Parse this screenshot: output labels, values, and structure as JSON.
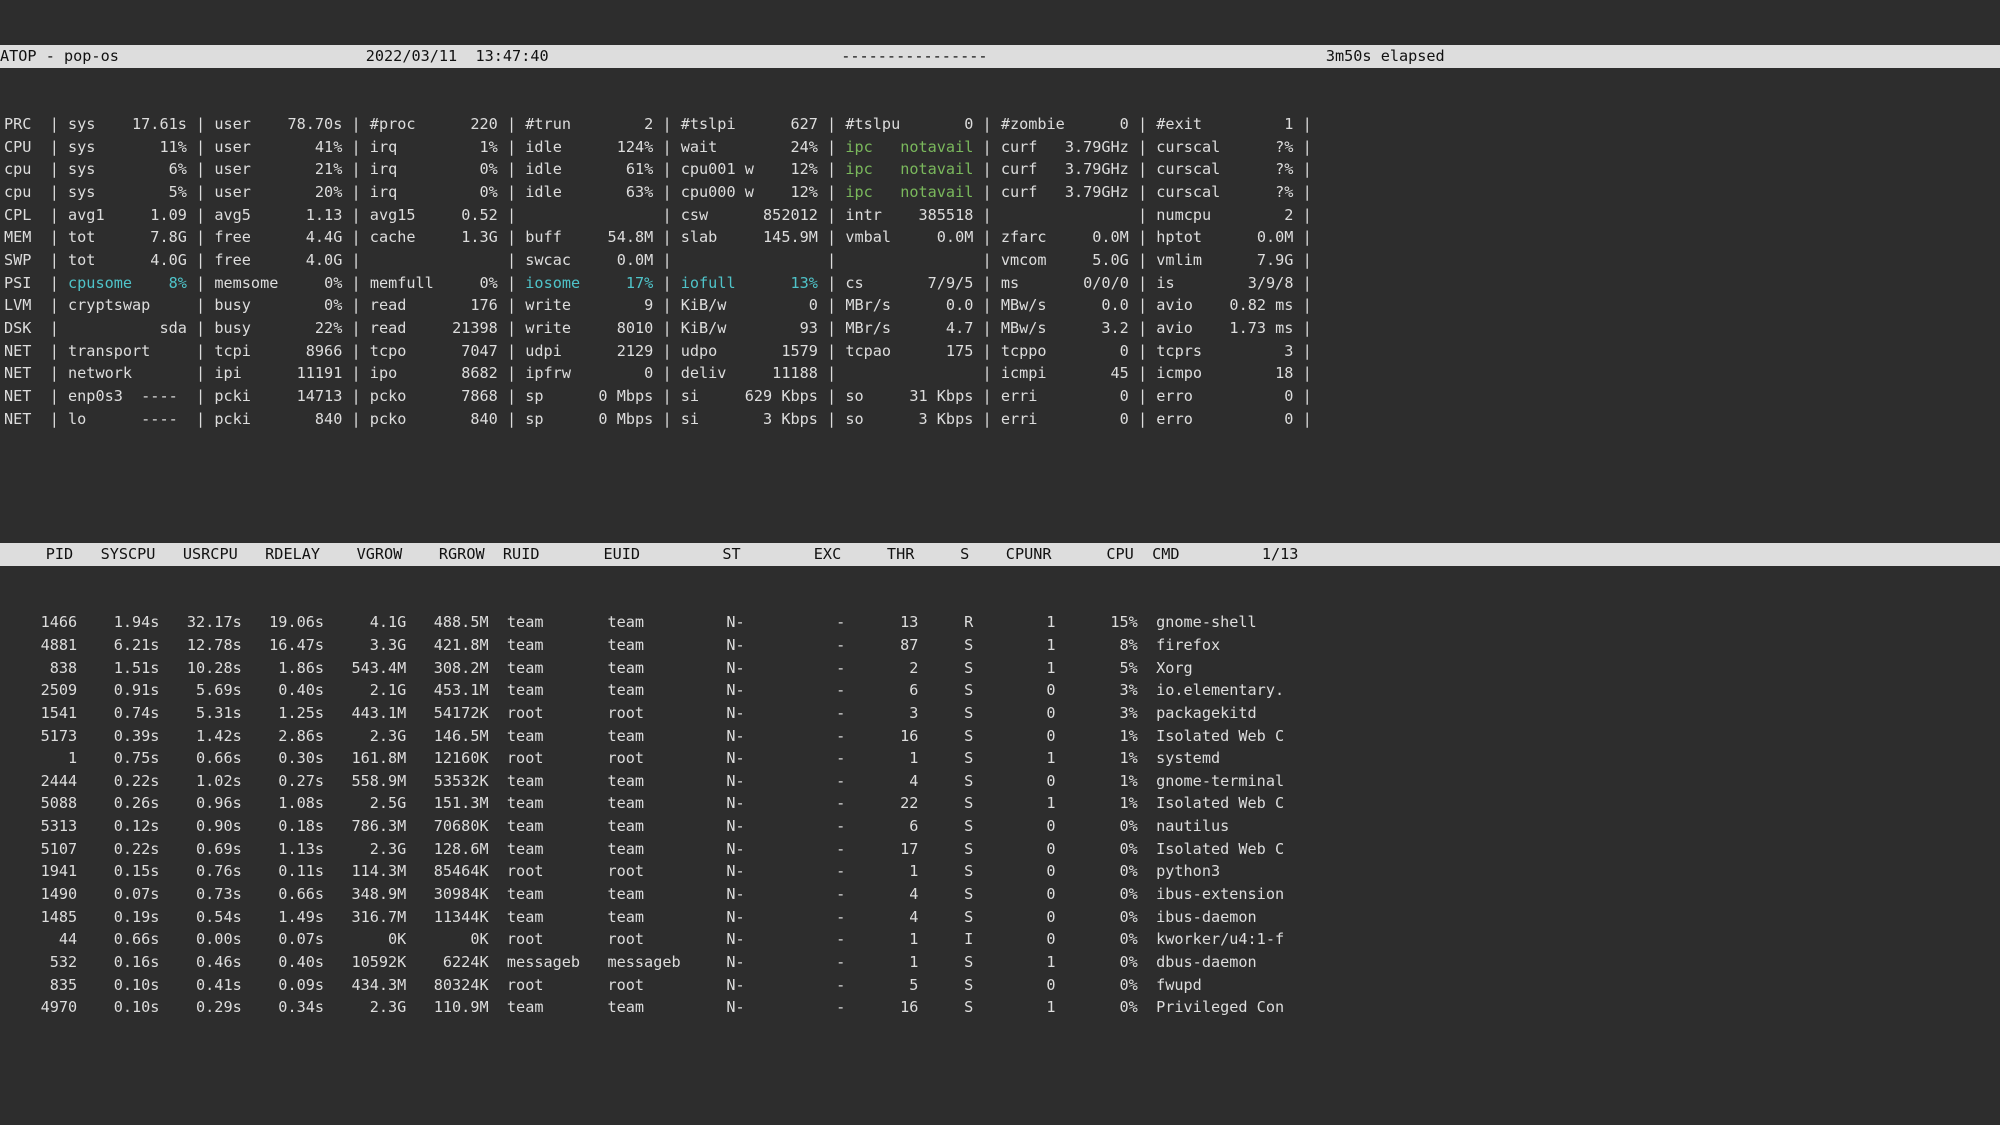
{
  "topbar": {
    "left": "ATOP - pop-os",
    "center": "2022/03/11  13:47:40",
    "dash": "----------------",
    "elapsed": "3m50s elapsed"
  },
  "sys": [
    {
      "c": [
        [
          "PRC",
          ""
        ],
        [
          "sys",
          "17.61s"
        ],
        [
          "user",
          "78.70s"
        ],
        [
          "#proc",
          "220"
        ],
        [
          "#trun",
          "2"
        ],
        [
          "#tslpi",
          "627"
        ],
        [
          "#tslpu",
          "0"
        ],
        [
          "#zombie",
          "0"
        ],
        [
          "#exit",
          "1"
        ]
      ]
    },
    {
      "c": [
        [
          "CPU",
          ""
        ],
        [
          "sys",
          "11%"
        ],
        [
          "user",
          "41%"
        ],
        [
          "irq",
          "1%"
        ],
        [
          "idle",
          "124%"
        ],
        [
          "wait",
          "24%"
        ],
        [
          "ipc",
          "notavail",
          "green"
        ],
        [
          "curf",
          "3.79GHz"
        ],
        [
          "curscal",
          "?%"
        ]
      ]
    },
    {
      "c": [
        [
          "cpu",
          ""
        ],
        [
          "sys",
          "6%"
        ],
        [
          "user",
          "21%"
        ],
        [
          "irq",
          "0%"
        ],
        [
          "idle",
          "61%"
        ],
        [
          "cpu001 w",
          "12%"
        ],
        [
          "ipc",
          "notavail",
          "green"
        ],
        [
          "curf",
          "3.79GHz"
        ],
        [
          "curscal",
          "?%"
        ]
      ]
    },
    {
      "c": [
        [
          "cpu",
          ""
        ],
        [
          "sys",
          "5%"
        ],
        [
          "user",
          "20%"
        ],
        [
          "irq",
          "0%"
        ],
        [
          "idle",
          "63%"
        ],
        [
          "cpu000 w",
          "12%"
        ],
        [
          "ipc",
          "notavail",
          "green"
        ],
        [
          "curf",
          "3.79GHz"
        ],
        [
          "curscal",
          "?%"
        ]
      ]
    },
    {
      "c": [
        [
          "CPL",
          ""
        ],
        [
          "avg1",
          "1.09"
        ],
        [
          "avg5",
          "1.13"
        ],
        [
          "avg15",
          "0.52"
        ],
        [
          "",
          ""
        ],
        [
          "csw",
          "852012"
        ],
        [
          "intr",
          "385518"
        ],
        [
          "",
          ""
        ],
        [
          "numcpu",
          "2"
        ]
      ]
    },
    {
      "c": [
        [
          "MEM",
          ""
        ],
        [
          "tot",
          "7.8G"
        ],
        [
          "free",
          "4.4G"
        ],
        [
          "cache",
          "1.3G"
        ],
        [
          "buff",
          "54.8M"
        ],
        [
          "slab",
          "145.9M"
        ],
        [
          "vmbal",
          "0.0M"
        ],
        [
          "zfarc",
          "0.0M"
        ],
        [
          "hptot",
          "0.0M"
        ]
      ]
    },
    {
      "c": [
        [
          "SWP",
          ""
        ],
        [
          "tot",
          "4.0G"
        ],
        [
          "free",
          "4.0G"
        ],
        [
          "",
          ""
        ],
        [
          "swcac",
          "0.0M"
        ],
        [
          "",
          ""
        ],
        [
          "",
          ""
        ],
        [
          "vmcom",
          "5.0G"
        ],
        [
          "vmlim",
          "7.9G"
        ]
      ]
    },
    {
      "c": [
        [
          "PSI",
          ""
        ],
        [
          "cpusome",
          "8%",
          "cyan"
        ],
        [
          "memsome",
          "0%"
        ],
        [
          "memfull",
          "0%"
        ],
        [
          "iosome",
          "17%",
          "cyan"
        ],
        [
          "iofull",
          "13%",
          "cyan"
        ],
        [
          "cs",
          "7/9/5"
        ],
        [
          "ms",
          "0/0/0"
        ],
        [
          "is",
          "3/9/8"
        ]
      ]
    },
    {
      "c": [
        [
          "LVM",
          ""
        ],
        [
          "cryptswap",
          ""
        ],
        [
          "busy",
          "0%"
        ],
        [
          "read",
          "176"
        ],
        [
          "write",
          "9"
        ],
        [
          "KiB/w",
          "0"
        ],
        [
          "MBr/s",
          "0.0"
        ],
        [
          "MBw/s",
          "0.0"
        ],
        [
          "avio",
          "0.82 ms"
        ]
      ]
    },
    {
      "c": [
        [
          "DSK",
          ""
        ],
        [
          "",
          "sda"
        ],
        [
          "busy",
          "22%"
        ],
        [
          "read",
          "21398"
        ],
        [
          "write",
          "8010"
        ],
        [
          "KiB/w",
          "93"
        ],
        [
          "MBr/s",
          "4.7"
        ],
        [
          "MBw/s",
          "3.2"
        ],
        [
          "avio",
          "1.73 ms"
        ]
      ]
    },
    {
      "c": [
        [
          "NET",
          ""
        ],
        [
          "transport",
          ""
        ],
        [
          "tcpi",
          "8966"
        ],
        [
          "tcpo",
          "7047"
        ],
        [
          "udpi",
          "2129"
        ],
        [
          "udpo",
          "1579"
        ],
        [
          "tcpao",
          "175"
        ],
        [
          "tcppo",
          "0"
        ],
        [
          "tcprs",
          "3"
        ]
      ]
    },
    {
      "c": [
        [
          "NET",
          ""
        ],
        [
          "network",
          ""
        ],
        [
          "ipi",
          "11191"
        ],
        [
          "ipo",
          "8682"
        ],
        [
          "ipfrw",
          "0"
        ],
        [
          "deliv",
          "11188"
        ],
        [
          "",
          ""
        ],
        [
          "icmpi",
          "45"
        ],
        [
          "icmpo",
          "18"
        ]
      ]
    },
    {
      "c": [
        [
          "NET",
          ""
        ],
        [
          "enp0s3  ----",
          ""
        ],
        [
          "pcki",
          "14713"
        ],
        [
          "pcko",
          "7868"
        ],
        [
          "sp",
          "0 Mbps"
        ],
        [
          "si",
          "629 Kbps"
        ],
        [
          "so",
          "31 Kbps"
        ],
        [
          "erri",
          "0"
        ],
        [
          "erro",
          "0"
        ]
      ]
    },
    {
      "c": [
        [
          "NET",
          ""
        ],
        [
          "lo      ----",
          ""
        ],
        [
          "pcki",
          "840"
        ],
        [
          "pcko",
          "840"
        ],
        [
          "sp",
          "0 Mbps"
        ],
        [
          "si",
          "3 Kbps"
        ],
        [
          "so",
          "3 Kbps"
        ],
        [
          "erri",
          "0"
        ],
        [
          "erro",
          "0"
        ]
      ]
    }
  ],
  "procHdr": [
    "PID",
    "SYSCPU",
    "USRCPU",
    "RDELAY",
    "VGROW",
    "RGROW",
    "RUID",
    "EUID",
    "ST",
    "EXC",
    "THR",
    "S",
    "CPUNR",
    "CPU",
    "CMD"
  ],
  "procPage": "1/13",
  "procs": [
    [
      "1466",
      "1.94s",
      "32.17s",
      "19.06s",
      "4.1G",
      "488.5M",
      "team",
      "team",
      "N-",
      "-",
      "13",
      "R",
      "1",
      "15%",
      "gnome-shell"
    ],
    [
      "4881",
      "6.21s",
      "12.78s",
      "16.47s",
      "3.3G",
      "421.8M",
      "team",
      "team",
      "N-",
      "-",
      "87",
      "S",
      "1",
      "8%",
      "firefox"
    ],
    [
      "838",
      "1.51s",
      "10.28s",
      "1.86s",
      "543.4M",
      "308.2M",
      "team",
      "team",
      "N-",
      "-",
      "2",
      "S",
      "1",
      "5%",
      "Xorg"
    ],
    [
      "2509",
      "0.91s",
      "5.69s",
      "0.40s",
      "2.1G",
      "453.1M",
      "team",
      "team",
      "N-",
      "-",
      "6",
      "S",
      "0",
      "3%",
      "io.elementary."
    ],
    [
      "1541",
      "0.74s",
      "5.31s",
      "1.25s",
      "443.1M",
      "54172K",
      "root",
      "root",
      "N-",
      "-",
      "3",
      "S",
      "0",
      "3%",
      "packagekitd"
    ],
    [
      "5173",
      "0.39s",
      "1.42s",
      "2.86s",
      "2.3G",
      "146.5M",
      "team",
      "team",
      "N-",
      "-",
      "16",
      "S",
      "0",
      "1%",
      "Isolated Web C"
    ],
    [
      "1",
      "0.75s",
      "0.66s",
      "0.30s",
      "161.8M",
      "12160K",
      "root",
      "root",
      "N-",
      "-",
      "1",
      "S",
      "1",
      "1%",
      "systemd"
    ],
    [
      "2444",
      "0.22s",
      "1.02s",
      "0.27s",
      "558.9M",
      "53532K",
      "team",
      "team",
      "N-",
      "-",
      "4",
      "S",
      "0",
      "1%",
      "gnome-terminal"
    ],
    [
      "5088",
      "0.26s",
      "0.96s",
      "1.08s",
      "2.5G",
      "151.3M",
      "team",
      "team",
      "N-",
      "-",
      "22",
      "S",
      "1",
      "1%",
      "Isolated Web C"
    ],
    [
      "5313",
      "0.12s",
      "0.90s",
      "0.18s",
      "786.3M",
      "70680K",
      "team",
      "team",
      "N-",
      "-",
      "6",
      "S",
      "0",
      "0%",
      "nautilus"
    ],
    [
      "5107",
      "0.22s",
      "0.69s",
      "1.13s",
      "2.3G",
      "128.6M",
      "team",
      "team",
      "N-",
      "-",
      "17",
      "S",
      "0",
      "0%",
      "Isolated Web C"
    ],
    [
      "1941",
      "0.15s",
      "0.76s",
      "0.11s",
      "114.3M",
      "85464K",
      "root",
      "root",
      "N-",
      "-",
      "1",
      "S",
      "0",
      "0%",
      "python3"
    ],
    [
      "1490",
      "0.07s",
      "0.73s",
      "0.66s",
      "348.9M",
      "30984K",
      "team",
      "team",
      "N-",
      "-",
      "4",
      "S",
      "0",
      "0%",
      "ibus-extension"
    ],
    [
      "1485",
      "0.19s",
      "0.54s",
      "1.49s",
      "316.7M",
      "11344K",
      "team",
      "team",
      "N-",
      "-",
      "4",
      "S",
      "0",
      "0%",
      "ibus-daemon"
    ],
    [
      "44",
      "0.66s",
      "0.00s",
      "0.07s",
      "0K",
      "0K",
      "root",
      "root",
      "N-",
      "-",
      "1",
      "I",
      "0",
      "0%",
      "kworker/u4:1-f"
    ],
    [
      "532",
      "0.16s",
      "0.46s",
      "0.40s",
      "10592K",
      "6224K",
      "messageb",
      "messageb",
      "N-",
      "-",
      "1",
      "S",
      "1",
      "0%",
      "dbus-daemon"
    ],
    [
      "835",
      "0.10s",
      "0.41s",
      "0.09s",
      "434.3M",
      "80324K",
      "root",
      "root",
      "N-",
      "-",
      "5",
      "S",
      "0",
      "0%",
      "fwupd"
    ],
    [
      "4970",
      "0.10s",
      "0.29s",
      "0.34s",
      "2.3G",
      "110.9M",
      "team",
      "team",
      "N-",
      "-",
      "16",
      "S",
      "1",
      "0%",
      "Privileged Con"
    ]
  ],
  "widths": {
    "sys": [
      4,
      14,
      15,
      15,
      15,
      16,
      15,
      15,
      16
    ],
    "proc": [
      7,
      9,
      9,
      9,
      9,
      9,
      11,
      13,
      8,
      7,
      8,
      6,
      9,
      9,
      18
    ]
  },
  "align": {
    "proc": [
      "r",
      "r",
      "r",
      "r",
      "r",
      "r",
      "l",
      "l",
      "l",
      "r",
      "r",
      "r",
      "r",
      "r",
      "l"
    ]
  }
}
